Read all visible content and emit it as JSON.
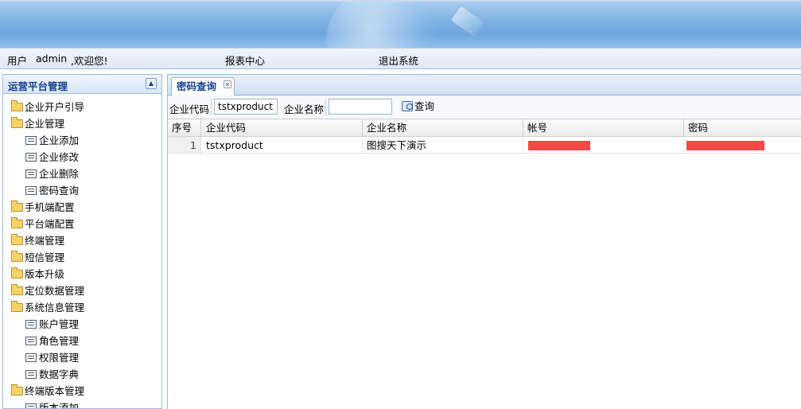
{
  "topbar": {
    "user_label": "用户",
    "username": "admin",
    "welcome": ",欢迎您!",
    "report_center": "报表中心",
    "logout": "退出系统"
  },
  "sidebar": {
    "title": "运营平台管理",
    "collapse_icon": "triangle-up-icon",
    "items": [
      {
        "label": "企业开户引导",
        "type": "folder"
      },
      {
        "label": "企业管理",
        "type": "folder"
      },
      {
        "label": "企业添加",
        "type": "leaf"
      },
      {
        "label": "企业修改",
        "type": "leaf"
      },
      {
        "label": "企业删除",
        "type": "leaf"
      },
      {
        "label": "密码查询",
        "type": "leaf"
      },
      {
        "label": "手机端配置",
        "type": "folder"
      },
      {
        "label": "平台端配置",
        "type": "folder"
      },
      {
        "label": "终端管理",
        "type": "folder"
      },
      {
        "label": "短信管理",
        "type": "folder"
      },
      {
        "label": "版本升级",
        "type": "folder"
      },
      {
        "label": "定位数据管理",
        "type": "folder"
      },
      {
        "label": "系统信息管理",
        "type": "folder"
      },
      {
        "label": "账户管理",
        "type": "leaf"
      },
      {
        "label": "角色管理",
        "type": "leaf"
      },
      {
        "label": "权限管理",
        "type": "leaf"
      },
      {
        "label": "数据字典",
        "type": "leaf"
      },
      {
        "label": "终端版本管理",
        "type": "folder"
      },
      {
        "label": "版本添加",
        "type": "leaf"
      }
    ]
  },
  "tabs": [
    {
      "label": "密码查询",
      "close_icon": "close-icon"
    }
  ],
  "search": {
    "code_label": "企业代码",
    "code_value": "tstxproduct",
    "name_label": "企业名称",
    "name_value": "",
    "query_label": "查询",
    "query_icon": "search-icon"
  },
  "grid": {
    "columns": [
      "序号",
      "企业代码",
      "企业名称",
      "帐号",
      "密码"
    ],
    "rows": [
      {
        "index": "1",
        "code": "tstxproduct",
        "name": "图搜天下演示",
        "account": "",
        "password": ""
      }
    ],
    "redact_color": "#f54848"
  },
  "colors": {
    "accent": "#15428b",
    "border": "#99bbe8"
  }
}
